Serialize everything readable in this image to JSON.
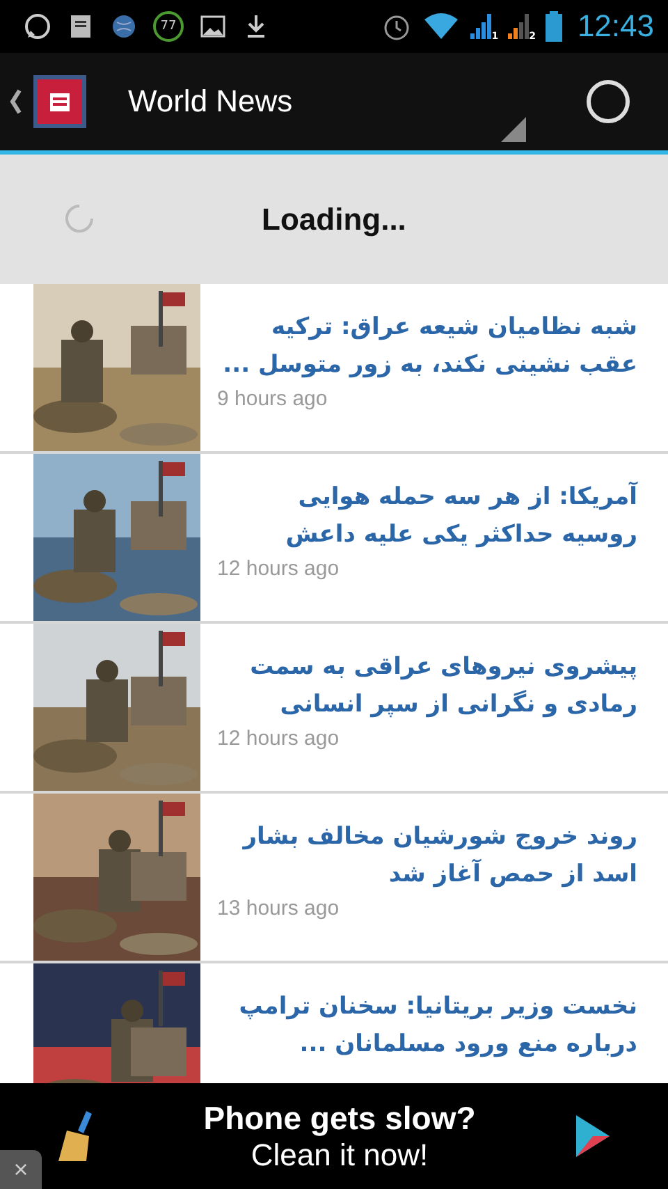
{
  "status_bar": {
    "badge_count": "77",
    "sim_1": "1",
    "sim_2": "2",
    "time": "12:43"
  },
  "action_bar": {
    "title": "World News"
  },
  "loading": {
    "text": "Loading..."
  },
  "articles": [
    {
      "headline": "شبه نظامیان شیعه عراق: ترکیه عقب نشینی نکند، به زور متوسل ...",
      "time": "9 hours ago",
      "kind": "picture"
    },
    {
      "headline": "آمریکا: از هر سه حمله هوایی روسیه حداکثر یکی علیه داعش",
      "time": "12 hours ago",
      "kind": "picture"
    },
    {
      "headline": "پیشروی نیروهای عراقی به سمت رمادی و نگرانی از سپر انسانی",
      "time": "12 hours ago",
      "kind": "picture"
    },
    {
      "headline": "روند خروج شورشیان مخالف بشار اسد از حمص آغاز شد",
      "time": "13 hours ago",
      "kind": "picture"
    },
    {
      "headline": "نخست وزیر بریتانیا: سخنان ترامپ درباره منع ورود مسلمانان ...",
      "kind": "picture"
    }
  ],
  "ad": {
    "line_1": "Phone gets slow?",
    "line_2": "Clean it now!",
    "close": "×"
  }
}
